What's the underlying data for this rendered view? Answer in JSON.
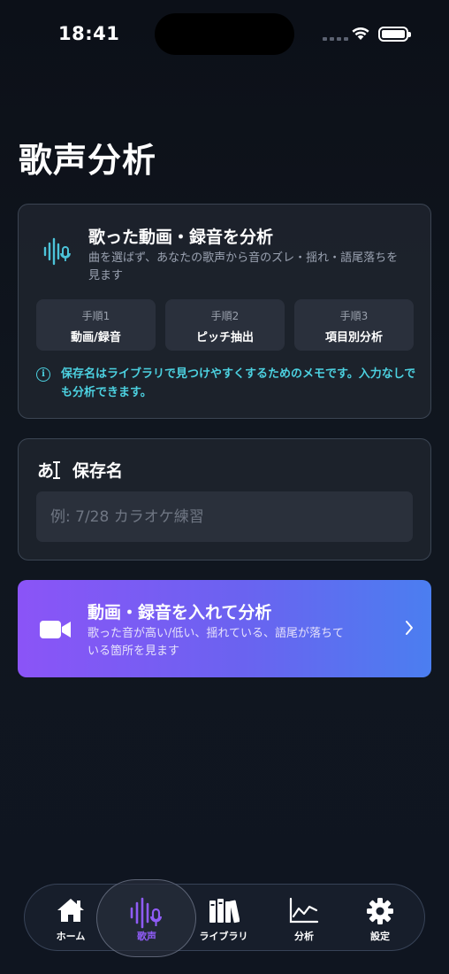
{
  "status_bar": {
    "time": "18:41"
  },
  "page": {
    "title": "歌声分析"
  },
  "analyze_card": {
    "title": "歌った動画・録音を分析",
    "description": "曲を選ばず、あなたの歌声から音のズレ・揺れ・語尾落ちを見ます",
    "icon": "waveform-mic-icon",
    "steps": [
      {
        "num": "手順1",
        "label": "動画/録音"
      },
      {
        "num": "手順2",
        "label": "ピッチ抽出"
      },
      {
        "num": "手順3",
        "label": "項目別分析"
      }
    ],
    "info_text": "保存名はライブラリで見つけやすくするためのメモです。入力なしでも分析できます。"
  },
  "name_card": {
    "icon_text": "あ",
    "label": "保存名",
    "placeholder": "例: 7/28 カラオケ練習",
    "value": ""
  },
  "cta": {
    "title": "動画・録音を入れて分析",
    "description": "歌った音が高い/低い、揺れている、語尾が落ちている箇所を見ます"
  },
  "tab_bar": {
    "active": "歌声",
    "items": [
      {
        "label": "ホーム",
        "icon": "home-icon"
      },
      {
        "label": "歌声",
        "icon": "waveform-mic-icon"
      },
      {
        "label": "ライブラリ",
        "icon": "books-icon"
      },
      {
        "label": "分析",
        "icon": "chart-icon"
      },
      {
        "label": "設定",
        "icon": "gear-icon"
      }
    ]
  },
  "colors": {
    "accent_cyan": "#4cd1e0",
    "accent_purple": "#8f5cf6",
    "cta_gradient_start": "#8b54f7",
    "cta_gradient_end": "#4b7ef0"
  }
}
